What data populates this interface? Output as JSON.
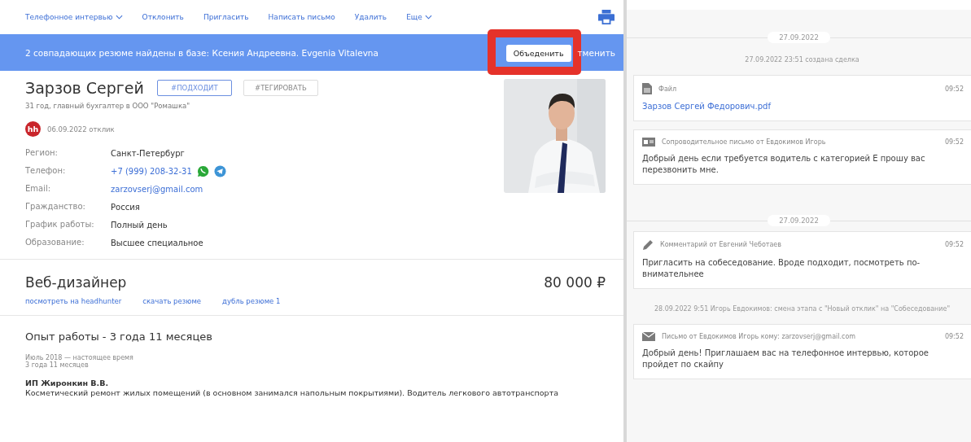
{
  "toolbar": {
    "actions": [
      {
        "label": "Телефонное интервью",
        "dropdown": true
      },
      {
        "label": "Отклонить",
        "dropdown": false
      },
      {
        "label": "Пригласить",
        "dropdown": false
      },
      {
        "label": "Написать письмо",
        "dropdown": false
      },
      {
        "label": "Удалить",
        "dropdown": false
      },
      {
        "label": "Еще",
        "dropdown": true
      }
    ]
  },
  "duplicate_banner": {
    "message": "2 совпадающих резюме найдены в базе: Ксения Андреевна. Evgenia Vitalevna",
    "merge_button": "Объеденить",
    "cancel_link": "тменить",
    "highlighted": true
  },
  "candidate": {
    "name": "Зарзов Сергей",
    "tags": [
      {
        "label": "#ПОДХОДИТ",
        "selected": true
      },
      {
        "label": "#ТЕГИРОВАТЬ",
        "selected": false
      }
    ],
    "subtitle": "31 год, главный бухгалтер в ООО \"Ромашка\"",
    "source_badge": "hh",
    "response": "06.09.2022 отклик",
    "fields": [
      {
        "label": "Регион:",
        "value": "Санкт-Петербург",
        "link": false,
        "messengers": false
      },
      {
        "label": "Телефон:",
        "value": "+7 (999) 208-32-31",
        "link": true,
        "messengers": true
      },
      {
        "label": "Email:",
        "value": "zarzovserj@gmail.com",
        "link": true,
        "messengers": false
      },
      {
        "label": "Гражданство:",
        "value": "Россия",
        "link": false,
        "messengers": false
      },
      {
        "label": "График работы:",
        "value": "Полный день",
        "link": false,
        "messengers": false
      },
      {
        "label": "Образование:",
        "value": "Высшее специальное",
        "link": false,
        "messengers": false
      }
    ]
  },
  "position": {
    "title": "Веб-дизайнер",
    "salary": "80 000 ₽",
    "links": [
      "посмотреть на headhunter",
      "скачать резюме",
      "дубль резюме 1"
    ]
  },
  "experience": {
    "title": "Опыт работы - 3 года 11 месяцев",
    "period": "Июль 2018 — настоящее время",
    "duration": "3 года 11 месяцев",
    "company": "ИП Жиронкин В.В.",
    "description": "Косметический ремонт жилых помещений (в основном занимался напольным покрытиями). Водитель легкового автотранспорта"
  },
  "timeline": [
    {
      "kind": "date",
      "text": "27.09.2022"
    },
    {
      "kind": "event",
      "text": "27.09.2022 23:51 создана сделка"
    },
    {
      "kind": "file",
      "header": "Файл",
      "time": "09:52",
      "body": "Зарзов Сергей Федорович.pdf"
    },
    {
      "kind": "cover_letter",
      "header": "Сопроводительное письмо от Евдокимов Игорь",
      "time": "09:52",
      "body": "Добрый день если требуется водитель с категорией Е прошу вас перезвонить мне."
    },
    {
      "kind": "date",
      "text": "27.09.2022"
    },
    {
      "kind": "comment",
      "header": "Комментарий от Евгений Чеботаев",
      "time": "09:52",
      "body": "Пригласить на собеседование. Вроде подходит, посмотреть по-внимательнее"
    },
    {
      "kind": "event",
      "text": "28.09.2022 9:51 Игорь Евдокимов: смена этапа с \"Новый отклик\" на \"Собеседование\""
    },
    {
      "kind": "email",
      "header": "Письмо от Евдокимов Игорь кому: zarzovserj@gmail.com",
      "time": "09:52",
      "body": "Добрый день! Приглашаем вас на телефонное интервью, которое пройдет по скайпу"
    }
  ]
}
